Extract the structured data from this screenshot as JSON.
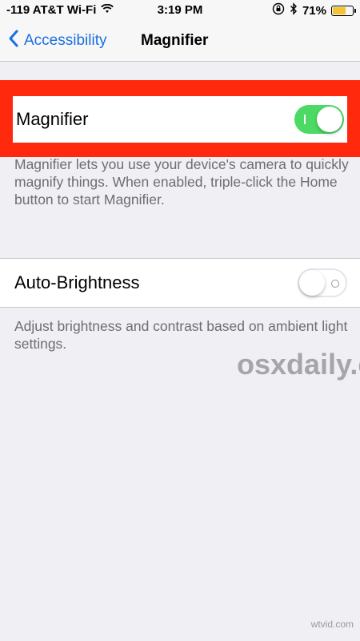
{
  "status_bar": {
    "carrier": "-119 AT&T Wi-Fi",
    "time": "3:19 PM",
    "battery_percent": "71%",
    "battery_level": 0.71,
    "battery_color": "#f5c330",
    "icons": [
      "wifi-icon",
      "orientation-lock-icon",
      "bluetooth-icon",
      "battery-icon"
    ]
  },
  "nav": {
    "back_label": "Accessibility",
    "title": "Magnifier",
    "accent": "#1a6fe0"
  },
  "magnifier": {
    "label": "Magnifier",
    "toggle_on": true,
    "toggle_on_color": "#4cd964",
    "highlight_color": "#ff2a0e",
    "footer": "Magnifier lets you use your device's camera to quickly magnify things. When enabled, triple-click the Home button to start Magnifier."
  },
  "auto_brightness": {
    "label": "Auto-Brightness",
    "toggle_on": false,
    "footer": "Adjust brightness and contrast based on ambient light settings."
  },
  "watermark": "osxdaily.com",
  "credit": "wtvid.com"
}
